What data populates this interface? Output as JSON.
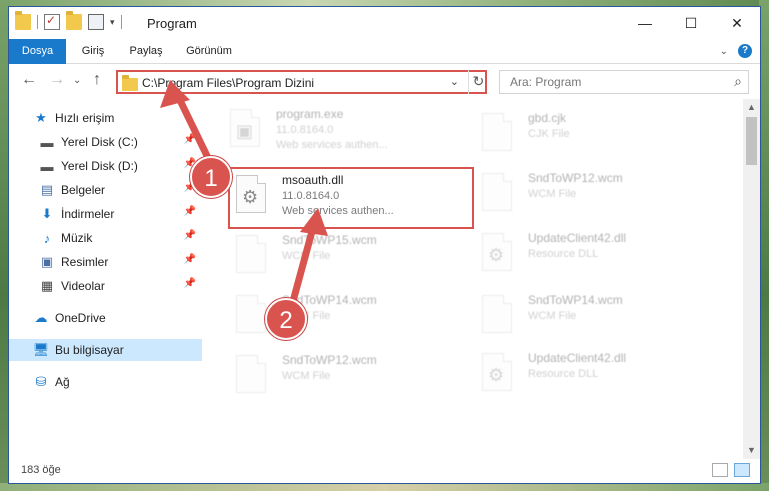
{
  "window": {
    "title": "Program",
    "controls": {
      "minimize": "—",
      "maximize": "☐",
      "close": "✕"
    }
  },
  "ribbon": {
    "tabs": [
      "Dosya",
      "Giriş",
      "Paylaş",
      "Görünüm"
    ],
    "help": "?"
  },
  "address": {
    "path": "C:\\Program Files\\Program Dizini",
    "search_placeholder": "Ara: Program"
  },
  "sidebar": {
    "items": [
      {
        "label": "Hızlı erişim",
        "icon": "star-icon",
        "pinned": false
      },
      {
        "label": "Yerel Disk (C:)",
        "icon": "drive-icon",
        "pinned": true
      },
      {
        "label": "Yerel Disk (D:)",
        "icon": "drive-icon",
        "pinned": true
      },
      {
        "label": "Belgeler",
        "icon": "document-icon",
        "pinned": true
      },
      {
        "label": "İndirmeler",
        "icon": "download-icon",
        "pinned": true
      },
      {
        "label": "Müzik",
        "icon": "music-icon",
        "pinned": true
      },
      {
        "label": "Resimler",
        "icon": "picture-icon",
        "pinned": true
      },
      {
        "label": "Videolar",
        "icon": "video-icon",
        "pinned": true
      },
      {
        "label": "OneDrive",
        "icon": "cloud-icon",
        "pinned": false
      },
      {
        "label": "Bu bilgisayar",
        "icon": "computer-icon",
        "pinned": false
      },
      {
        "label": "Ağ",
        "icon": "network-icon",
        "pinned": false
      }
    ]
  },
  "files": {
    "left": [
      {
        "name": "program.exe",
        "line1": "11.0.8164.0",
        "line2": "Web services authen...",
        "icon": "exe-icon",
        "faded": true
      },
      {
        "name": "msoauth.dll",
        "line1": "11.0.8164.0",
        "line2": "Web services authen...",
        "icon": "dll-gear-icon",
        "faded": false
      },
      {
        "name": "SndToWP15.wcm",
        "line1": "WCM File",
        "line2": "",
        "icon": "file-icon",
        "faded": true
      },
      {
        "name": "SndToWP14.wcm",
        "line1": "WCM File",
        "line2": "",
        "icon": "file-icon",
        "faded": true
      },
      {
        "name": "SndToWP12.wcm",
        "line1": "WCM File",
        "line2": "",
        "icon": "file-icon",
        "faded": true
      }
    ],
    "right": [
      {
        "name": "gbd.cjk",
        "line1": "CJK File",
        "line2": "",
        "icon": "file-icon",
        "faded": true
      },
      {
        "name": "SndToWP12.wcm",
        "line1": "WCM File",
        "line2": "",
        "icon": "file-icon",
        "faded": true
      },
      {
        "name": "UpdateClient42.dll",
        "line1": "Resource DLL",
        "line2": "",
        "icon": "dll-gear-icon",
        "faded": true
      },
      {
        "name": "SndToWP14.wcm",
        "line1": "WCM File",
        "line2": "",
        "icon": "file-icon",
        "faded": true
      },
      {
        "name": "UpdateClient42.dll",
        "line1": "Resource DLL",
        "line2": "",
        "icon": "dll-gear-icon",
        "faded": true
      }
    ]
  },
  "status": {
    "count": "183 öğe"
  },
  "annotations": {
    "badge1": "1",
    "badge2": "2",
    "accent": "#d9534f"
  }
}
